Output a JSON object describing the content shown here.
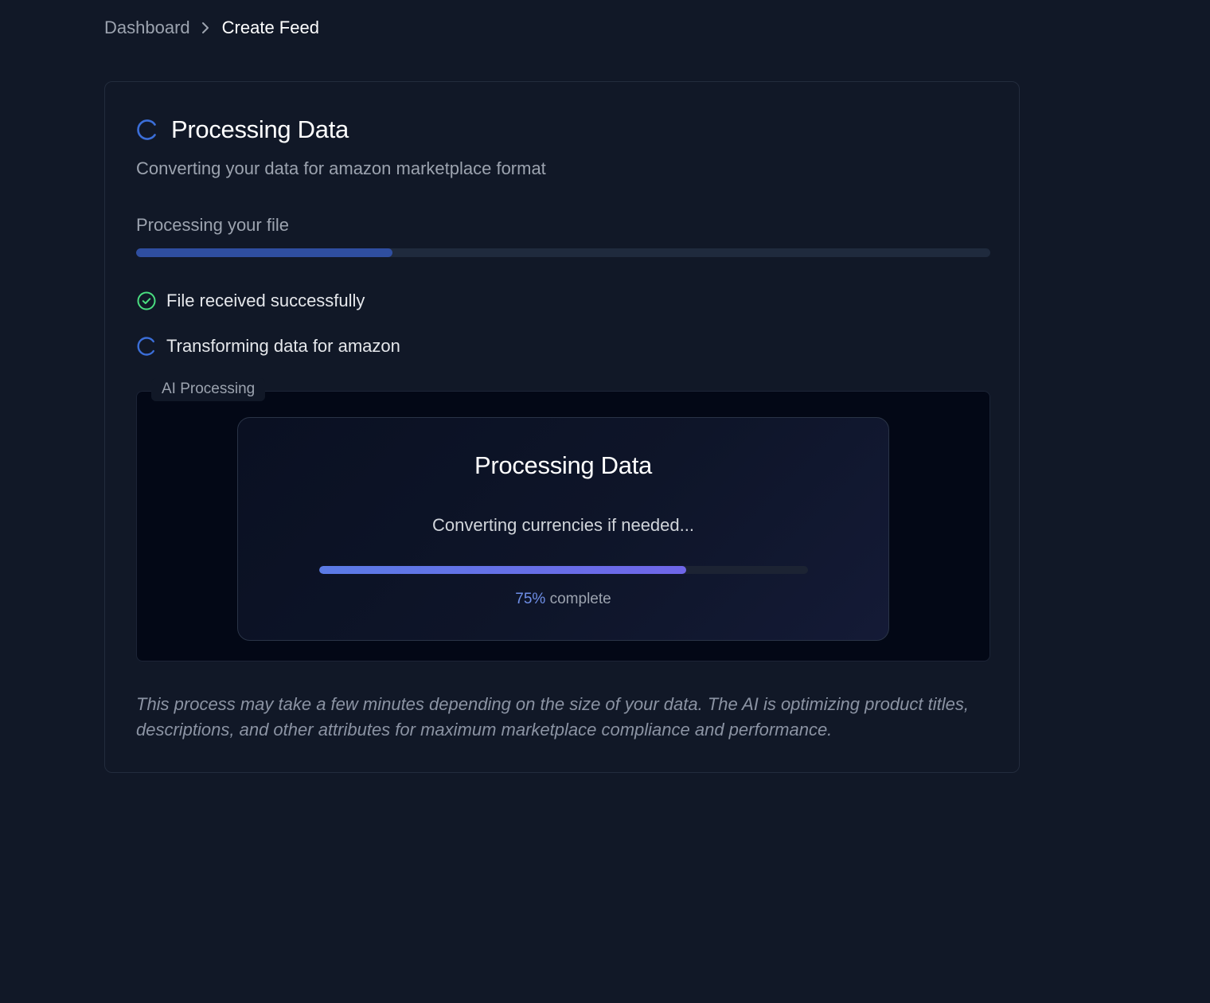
{
  "breadcrumb": {
    "parent": "Dashboard",
    "current": "Create Feed"
  },
  "card": {
    "title": "Processing Data",
    "subtitle": "Converting your data for amazon marketplace format",
    "progress_label": "Processing your file",
    "progress_fraction": 0.3,
    "steps": [
      {
        "label": "File received successfully",
        "status": "complete"
      },
      {
        "label": "Transforming data for amazon",
        "status": "in-progress"
      }
    ],
    "ai_panel": {
      "tag": "AI Processing",
      "title": "Processing Data",
      "status": "Converting currencies if needed...",
      "percent": "75%",
      "percent_suffix": " complete",
      "progress_fraction": 0.75
    },
    "footnote": "This process may take a few minutes depending on the size of your data. The AI is optimizing product titles, descriptions, and other attributes for maximum marketplace compliance and performance."
  },
  "colors": {
    "background": "#111827",
    "accent_blue": "#3b6ed8",
    "success_green": "#4ade80",
    "progress_fill": "#2f4ea0",
    "ai_gradient_start": "#5b7be6",
    "ai_gradient_end": "#6f66e8"
  },
  "icons": [
    "chevron-right-icon",
    "spinner-icon",
    "check-circle-icon"
  ]
}
